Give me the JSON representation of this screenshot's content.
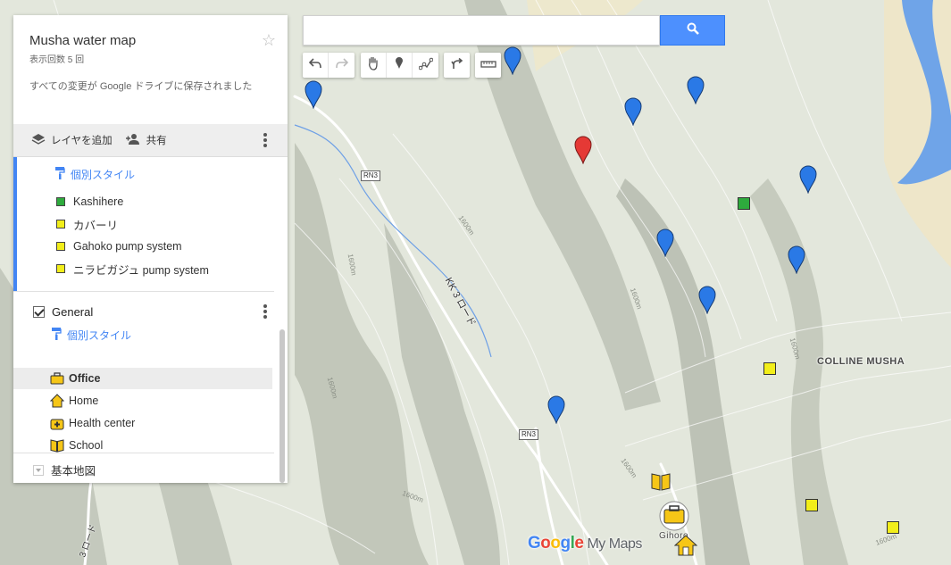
{
  "map": {
    "road_labels": [
      "RN3",
      "RN3"
    ],
    "road_name": "KK 3 ロード",
    "road_name_left": "3 ロード",
    "contour_labels": [
      "1600m",
      "1600m",
      "1600m",
      "1600m",
      "1600m",
      "1600m",
      "1600m",
      "1600m"
    ],
    "place_label": "COLLINE MUSHA",
    "town_label": "Gihoro",
    "pin_colors": {
      "blue": "#2a79e6",
      "red": "#e53935"
    },
    "square_colors": {
      "green": "#2eab3d",
      "yellow": "#f2ee1a"
    }
  },
  "brand": {
    "google": [
      "G",
      "o",
      "o",
      "g",
      "l",
      "e"
    ],
    "product": "My Maps"
  },
  "search": {
    "value": "",
    "placeholder": ""
  },
  "toolbar": {
    "undo": "undo-icon",
    "redo": "redo-icon",
    "hand": "hand-icon",
    "marker": "marker-icon",
    "line": "draw-line-icon",
    "directions": "directions-icon",
    "measure": "ruler-icon"
  },
  "panel": {
    "title": "Musha water map",
    "views": "表示回数 5 回",
    "saved": "すべての変更が Google ドライブに保存されました",
    "add_layer": "レイヤを追加",
    "share": "共有",
    "layer1": {
      "style_link": "個別スタイル",
      "items": [
        {
          "label": "Kashihere",
          "color": "#2eab3d"
        },
        {
          "label": "カバーリ",
          "color": "#f2ee1a"
        },
        {
          "label": "Gahoko pump system",
          "color": "#f2ee1a"
        },
        {
          "label": "ニラビガジュ pump system",
          "color": "#f2ee1a"
        }
      ]
    },
    "layer2": {
      "title": "General",
      "style_link": "個別スタイル",
      "items": [
        {
          "label": "Office",
          "icon": "briefcase-icon"
        },
        {
          "label": "Home",
          "icon": "house-icon"
        },
        {
          "label": "Health center",
          "icon": "medical-kit-icon"
        },
        {
          "label": "School",
          "icon": "book-icon"
        }
      ]
    },
    "base_map": "基本地図"
  }
}
